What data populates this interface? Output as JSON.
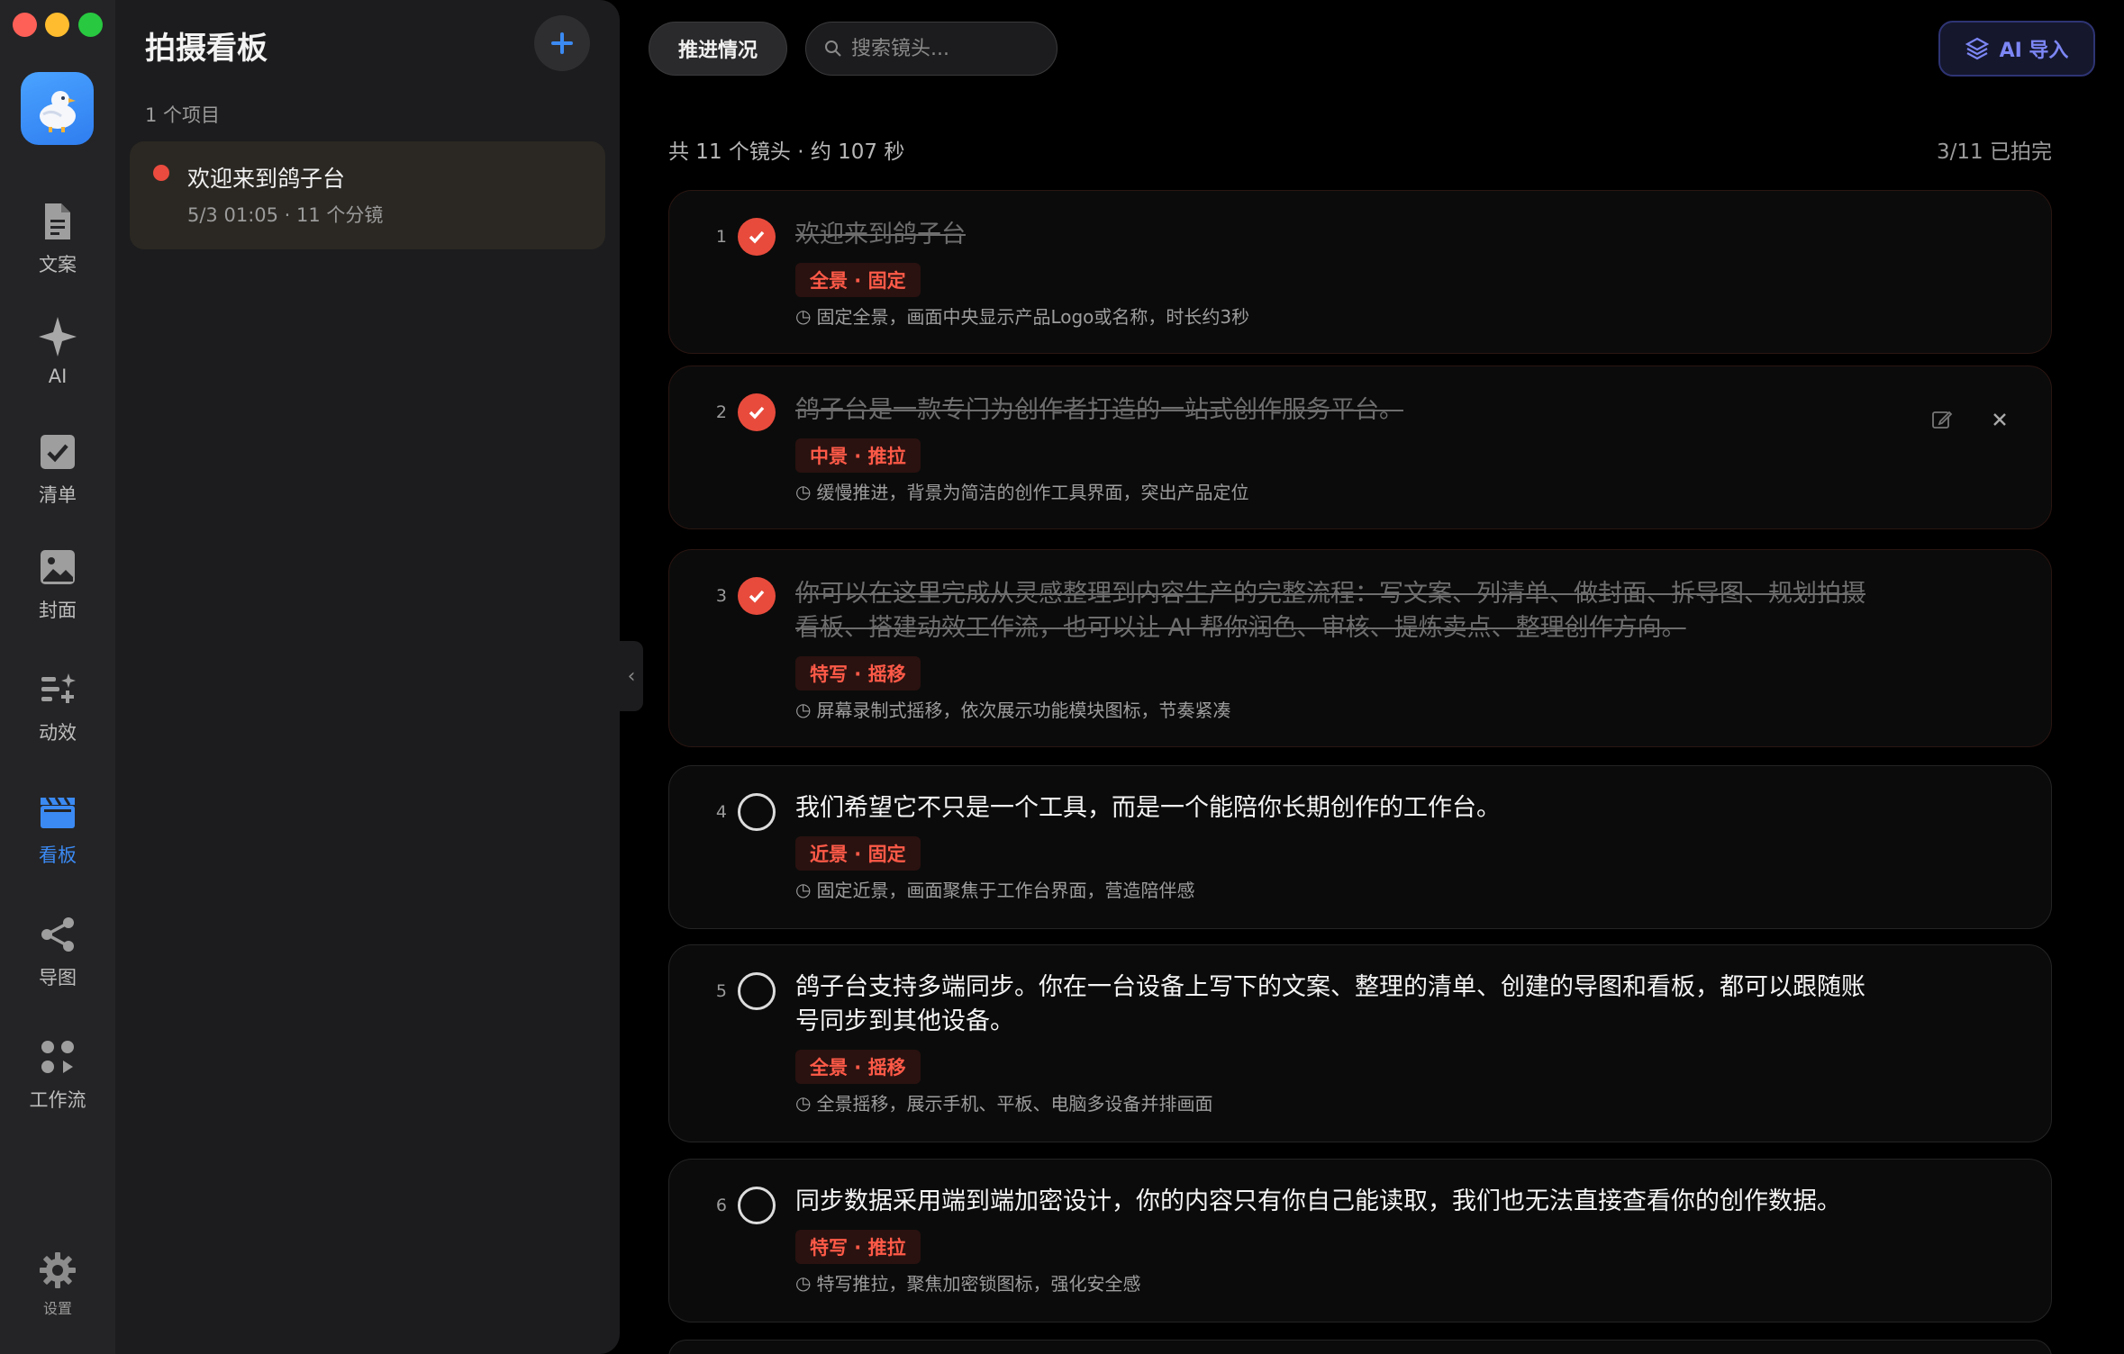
{
  "rail": {
    "items": [
      {
        "label": "文案",
        "icon": "document-icon"
      },
      {
        "label": "AI",
        "icon": "sparkle-icon"
      },
      {
        "label": "清单",
        "icon": "checklist-icon"
      },
      {
        "label": "封面",
        "icon": "image-icon"
      },
      {
        "label": "动效",
        "icon": "motion-icon"
      },
      {
        "label": "看板",
        "icon": "clapperboard-icon",
        "active": true
      },
      {
        "label": "导图",
        "icon": "share-graph-icon"
      },
      {
        "label": "工作流",
        "icon": "workflow-icon"
      }
    ],
    "settings_label": "设置"
  },
  "sidebar": {
    "title": "拍摄看板",
    "count": "1 个项目",
    "projects": [
      {
        "title": "欢迎来到鸽子台",
        "meta": "5/3 01:05 · 11 个分镜"
      }
    ]
  },
  "toolbar": {
    "progress_label": "推进情况",
    "search_placeholder": "搜索镜头...",
    "ai_import_label": "AI 导入"
  },
  "summary": {
    "text": "共 11 个镜头 · 约 107 秒",
    "done": "3/11 已拍完"
  },
  "shots": [
    {
      "num": "1",
      "done": true,
      "text": "欢迎来到鸽子台",
      "tag": "全景 · 固定",
      "desc": "固定全景，画面中央显示产品Logo或名称，时长约3秒"
    },
    {
      "num": "2",
      "done": true,
      "text": "鸽子台是一款专门为创作者打造的一站式创作服务平台。",
      "tag": "中景 · 推拉",
      "desc": "缓慢推进，背景为简洁的创作工具界面，突出产品定位"
    },
    {
      "num": "3",
      "done": true,
      "text": "你可以在这里完成从灵感整理到内容生产的完整流程：写文案、列清单、做封面、拆导图、规划拍摄看板、搭建动效工作流，也可以让 AI 帮你润色、审核、提炼卖点、整理创作方向。",
      "tag": "特写 · 摇移",
      "desc": "屏幕录制式摇移，依次展示功能模块图标，节奏紧凑"
    },
    {
      "num": "4",
      "done": false,
      "text": "我们希望它不只是一个工具，而是一个能陪你长期创作的工作台。",
      "tag": "近景 · 固定",
      "desc": "固定近景，画面聚焦于工作台界面，营造陪伴感"
    },
    {
      "num": "5",
      "done": false,
      "text": "鸽子台支持多端同步。你在一台设备上写下的文案、整理的清单、创建的导图和看板，都可以跟随账号同步到其他设备。",
      "tag": "全景 · 摇移",
      "desc": "全景摇移，展示手机、平板、电脑多设备并排画面"
    },
    {
      "num": "6",
      "done": false,
      "text": "同步数据采用端到端加密设计，你的内容只有你自己能读取，我们也无法直接查看你的创作数据。",
      "tag": "特写 · 推拉",
      "desc": "特写推拉，聚焦加密锁图标，强化安全感"
    }
  ],
  "colors": {
    "accent_red": "#e84b3c",
    "accent_blue": "#3b8af3",
    "ai_purple": "#7c86f4"
  }
}
